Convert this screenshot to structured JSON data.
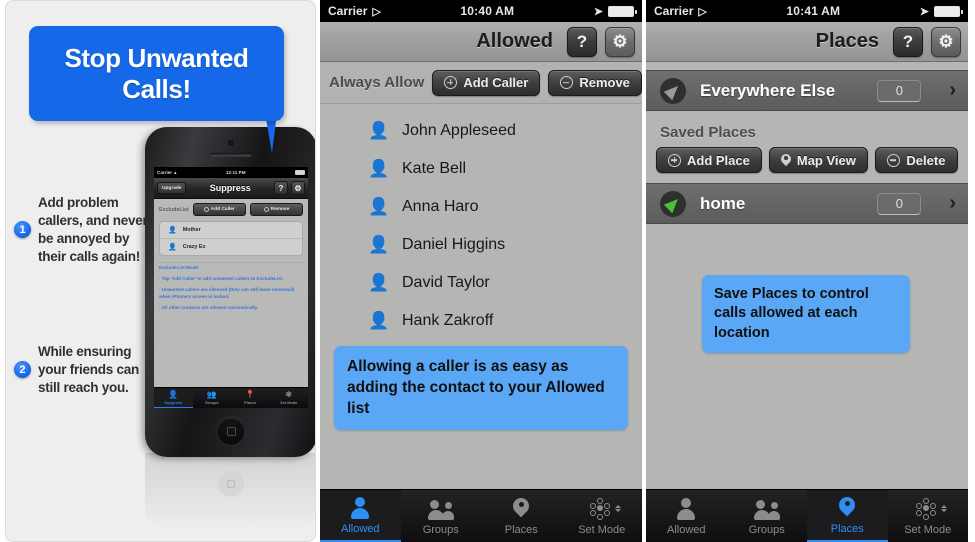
{
  "panel1": {
    "headline_line1": "Stop Unwanted",
    "headline_line2": "Calls!",
    "bullets": [
      {
        "num": "1",
        "text": "Add problem callers, and never be annoyed by their calls again!"
      },
      {
        "num": "2",
        "text": "While ensuring your friends can still reach you."
      }
    ],
    "phone": {
      "status": {
        "carrier": "Carrier",
        "wifi_icon": "wifi-icon",
        "time": "12:11 PM",
        "battery_icon": "battery-icon"
      },
      "nav": {
        "left_button": "Upgrade",
        "title": "Suppress",
        "help_button": "?",
        "settings_icon": "gear-icon"
      },
      "toolbar": {
        "label": "ExcludeList",
        "add_button": "Add Caller",
        "remove_button": "Remove"
      },
      "contacts": [
        {
          "name": "Mother",
          "icon": "person-icon"
        },
        {
          "name": "Crazy Ex",
          "icon": "person-icon"
        }
      ],
      "help": {
        "title": "ExcludeList Mode:",
        "lines": [
          "· Tap 'Add Caller' to add unwanted callers to ExcludeList.",
          "·  Unwanted callers are silenced (they can still leave voicemail) when iPhone's screen is locked.",
          "· All other contacts are allowed automatically."
        ]
      },
      "tabs": [
        {
          "label": "Suppress",
          "icon": "person-icon",
          "active": true
        },
        {
          "label": "Groups",
          "icon": "group-icon",
          "active": false
        },
        {
          "label": "Places",
          "icon": "map-pin-icon",
          "active": false
        },
        {
          "label": "Set Mode",
          "icon": "set-mode-icon",
          "active": false
        }
      ]
    }
  },
  "panel2": {
    "status": {
      "carrier": "Carrier",
      "wifi_icon": "wifi-icon",
      "time": "10:40 AM",
      "location_icon": "location-arrow-icon",
      "battery_icon": "battery-icon"
    },
    "nav": {
      "title": "Allowed",
      "help_button": "?",
      "settings_icon": "gear-icon"
    },
    "toolbar": {
      "label": "Always Allow",
      "add_button": "Add Caller",
      "remove_button": "Remove"
    },
    "contacts": [
      {
        "name": "John Appleseed",
        "icon": "person-icon"
      },
      {
        "name": "Kate Bell",
        "icon": "person-icon"
      },
      {
        "name": "Anna Haro",
        "icon": "person-icon"
      },
      {
        "name": "Daniel Higgins",
        "icon": "person-icon"
      },
      {
        "name": "David Taylor",
        "icon": "person-icon"
      },
      {
        "name": "Hank Zakroff",
        "icon": "person-icon"
      }
    ],
    "callout": "Allowing a caller is as easy as adding the contact to your Allowed list",
    "tabs": [
      {
        "label": "Allowed",
        "icon": "person-icon",
        "active": true
      },
      {
        "label": "Groups",
        "icon": "group-icon",
        "active": false
      },
      {
        "label": "Places",
        "icon": "map-pin-icon",
        "active": false
      },
      {
        "label": "Set Mode",
        "icon": "set-mode-icon",
        "active": false
      }
    ]
  },
  "panel3": {
    "status": {
      "carrier": "Carrier",
      "wifi_icon": "wifi-icon",
      "time": "10:41 AM",
      "location_icon": "location-arrow-icon",
      "battery_icon": "battery-icon"
    },
    "nav": {
      "title": "Places",
      "help_button": "?",
      "settings_icon": "gear-icon"
    },
    "everywhere_row": {
      "name": "Everywhere Else",
      "count": "0",
      "chevron": "›",
      "arrow_icon": "navigation-arrow-icon"
    },
    "section_label": "Saved Places",
    "tools": {
      "add_button": "Add Place",
      "map_button": "Map View",
      "delete_button": "Delete"
    },
    "home_row": {
      "name": "home",
      "count": "0",
      "chevron": "›",
      "arrow_icon": "navigation-arrow-icon"
    },
    "callout": "Save Places to control calls allowed at each location",
    "tabs": [
      {
        "label": "Allowed",
        "icon": "person-icon",
        "active": false
      },
      {
        "label": "Groups",
        "icon": "group-icon",
        "active": false
      },
      {
        "label": "Places",
        "icon": "map-pin-icon",
        "active": true
      },
      {
        "label": "Set Mode",
        "icon": "set-mode-icon",
        "active": false
      }
    ]
  },
  "colors": {
    "accent_blue": "#1569e8",
    "callout_blue": "#5aa7f5",
    "tab_active_blue": "#2f8ef5",
    "green_arrow": "#46c23a"
  }
}
